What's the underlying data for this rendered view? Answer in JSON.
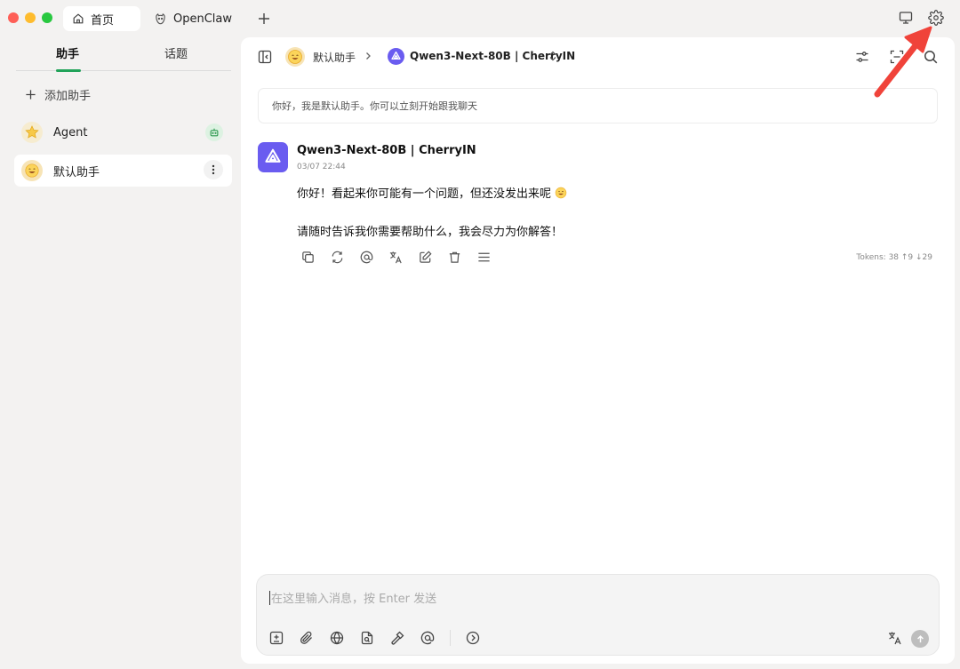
{
  "titlebar": {
    "tabs": [
      {
        "label": "首页",
        "icon": "home-icon",
        "active": true
      },
      {
        "label": "OpenClaw",
        "icon": "claw-icon",
        "active": false
      }
    ],
    "add_tab_icon": "plus-icon",
    "right_icons": [
      "monitor-icon",
      "gear-icon"
    ]
  },
  "sidebar": {
    "tabs": [
      "助手",
      "话题"
    ],
    "add_label": "添加助手",
    "items": [
      {
        "label": "Agent",
        "avatar": "star-emoji",
        "badge": "robot-icon"
      },
      {
        "label": "默认助手",
        "avatar": "smiley-emoji",
        "selected": true
      }
    ]
  },
  "header": {
    "assistant": "默认助手",
    "model": "Qwen3-Next-80B | CherryIN"
  },
  "chat": {
    "prompt": "你好，我是默认助手。你可以立刻开始跟我聊天",
    "message": {
      "model": "Qwen3-Next-80B | CherryIN",
      "time": "03/07 22:44",
      "line1": "你好！看起来你可能有一个问题，但还没发出来呢",
      "line2": "请随时告诉我你需要帮助什么，我会尽力为你解答！",
      "tokens": "Tokens: 38 ↑9 ↓29"
    }
  },
  "input": {
    "placeholder": "在这里输入消息，按 Enter 发送"
  },
  "colors": {
    "accent": "#22a35a",
    "model_brand": "#6a5cf0",
    "annotation": "#f0433a"
  }
}
